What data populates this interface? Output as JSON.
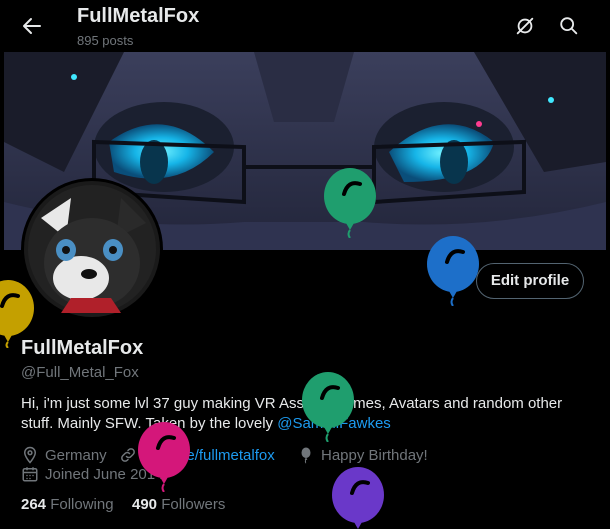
{
  "header": {
    "title": "FullMetalFox",
    "post_count": "895 posts"
  },
  "profile": {
    "display_name": "FullMetalFox",
    "handle": "@Full_Metal_Fox",
    "bio_text": "Hi, i'm just some lvl 37 guy making VR Assets, Memes, Avatars and random other stuff. Mainly SFW. Taken by the lovely ",
    "bio_mention": "@SammiFawkes",
    "location": "Germany",
    "website": "linktr.ee/fullmetalfox",
    "birthday": "Happy Birthday!",
    "joined": "Joined June 2014",
    "following_count": "264",
    "following_label": "Following",
    "followers_count": "490",
    "followers_label": "Followers",
    "edit_button_label": "Edit profile"
  },
  "icons": {
    "back": "back-arrow-icon",
    "grok": "grok-icon",
    "search": "search-icon",
    "location": "location-icon",
    "link": "link-icon",
    "birthday": "balloon-icon",
    "calendar": "calendar-icon"
  },
  "colors": {
    "background": "#000000",
    "text_primary": "#e7e9ea",
    "text_secondary": "#71767b",
    "link": "#1d9bf0",
    "balloon_green": "#1f9e6e",
    "balloon_blue": "#1d6fc9",
    "balloon_yellow": "#c4a000",
    "balloon_pink": "#d4177a",
    "balloon_purple": "#6a38c9"
  }
}
